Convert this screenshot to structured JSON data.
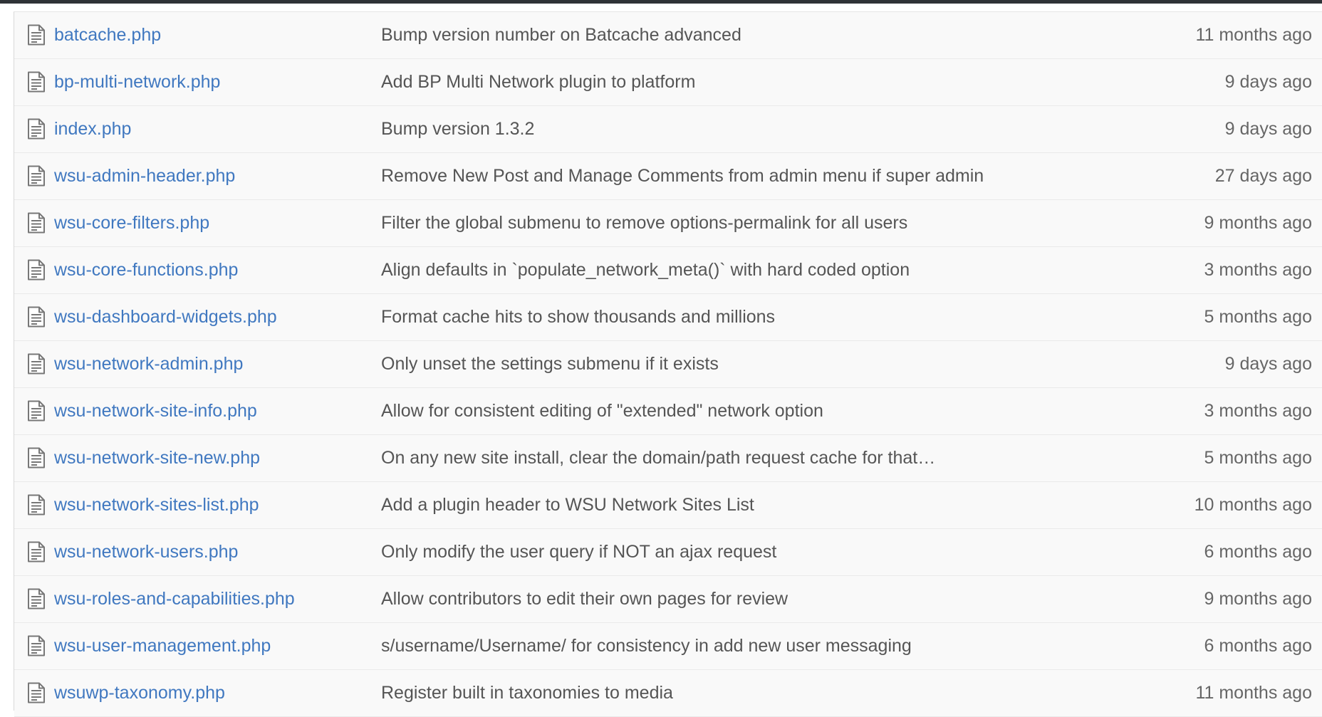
{
  "colors": {
    "link": "#4078c0",
    "message": "#555555",
    "age": "#666666",
    "row_background": "#f9f9f9",
    "top_bar": "#2f3337"
  },
  "file_list": {
    "icon": "file-text-icon",
    "rows": [
      {
        "name": "batcache.php",
        "message": "Bump version number on Batcache advanced",
        "age": "11 months ago"
      },
      {
        "name": "bp-multi-network.php",
        "message": "Add BP Multi Network plugin to platform",
        "age": "9 days ago"
      },
      {
        "name": "index.php",
        "message": "Bump version 1.3.2",
        "age": "9 days ago"
      },
      {
        "name": "wsu-admin-header.php",
        "message": "Remove New Post and Manage Comments from admin menu if super admin",
        "age": "27 days ago"
      },
      {
        "name": "wsu-core-filters.php",
        "message": "Filter the global submenu to remove options-permalink for all users",
        "age": "9 months ago"
      },
      {
        "name": "wsu-core-functions.php",
        "message": "Align defaults in `populate_network_meta()` with hard coded option",
        "age": "3 months ago"
      },
      {
        "name": "wsu-dashboard-widgets.php",
        "message": "Format cache hits to show thousands and millions",
        "age": "5 months ago"
      },
      {
        "name": "wsu-network-admin.php",
        "message": "Only unset the settings submenu if it exists",
        "age": "9 days ago"
      },
      {
        "name": "wsu-network-site-info.php",
        "message": "Allow for consistent editing of \"extended\" network option",
        "age": "3 months ago"
      },
      {
        "name": "wsu-network-site-new.php",
        "message": "On any new site install, clear the domain/path request cache for that…",
        "age": "5 months ago"
      },
      {
        "name": "wsu-network-sites-list.php",
        "message": "Add a plugin header to WSU Network Sites List",
        "age": "10 months ago"
      },
      {
        "name": "wsu-network-users.php",
        "message": "Only modify the user query if NOT an ajax request",
        "age": "6 months ago"
      },
      {
        "name": "wsu-roles-and-capabilities.php",
        "message": "Allow contributors to edit their own pages for review",
        "age": "9 months ago"
      },
      {
        "name": "wsu-user-management.php",
        "message": "s/username/Username/ for consistency in add new user messaging",
        "age": "6 months ago"
      },
      {
        "name": "wsuwp-taxonomy.php",
        "message": "Register built in taxonomies to media",
        "age": "11 months ago"
      }
    ]
  }
}
